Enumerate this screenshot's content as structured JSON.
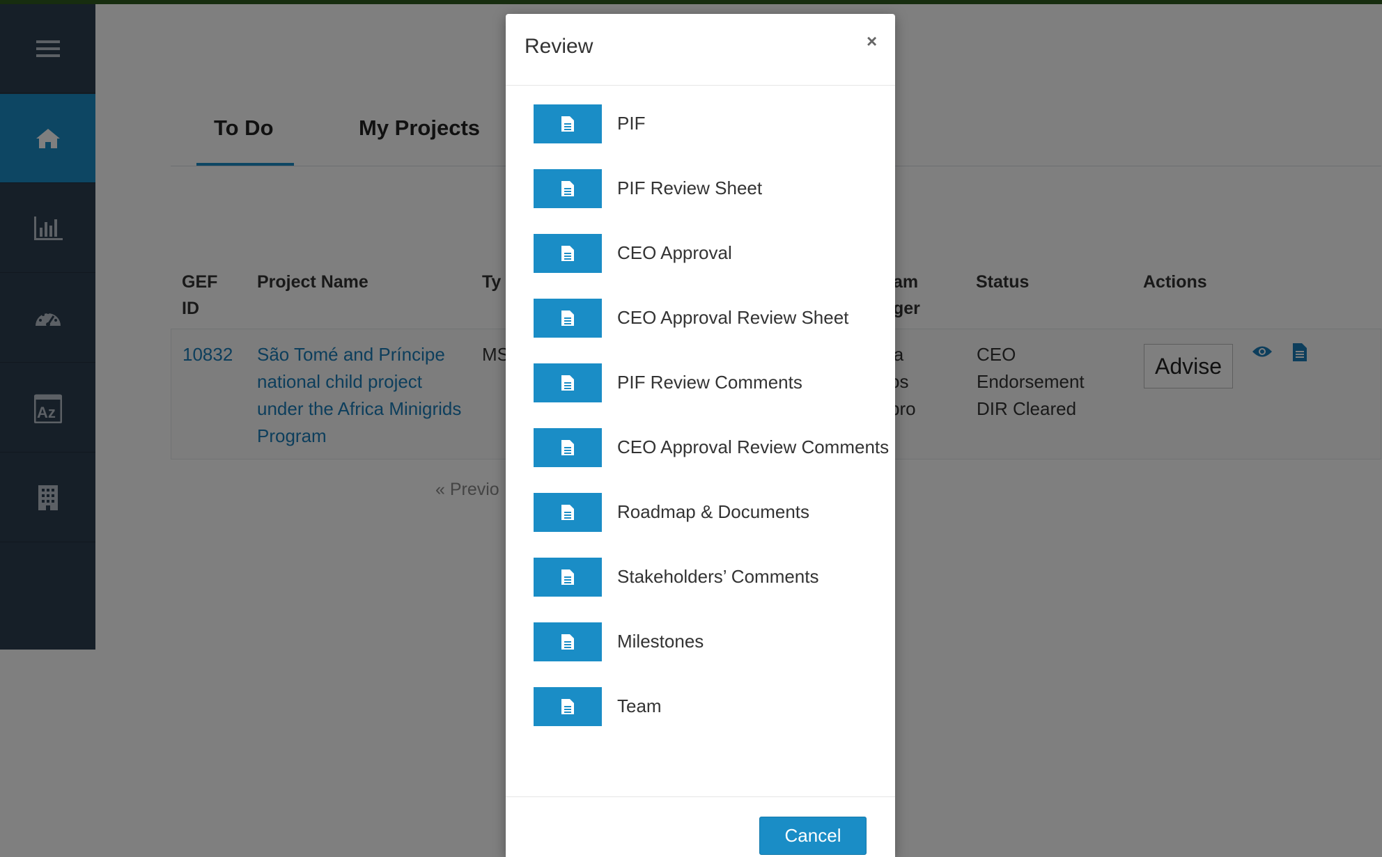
{
  "sidebar": {
    "items": [
      {
        "icon": "menu-icon"
      },
      {
        "icon": "home-icon"
      },
      {
        "icon": "bar-chart-icon"
      },
      {
        "icon": "dashboard-icon"
      },
      {
        "icon": "sort-az-icon"
      },
      {
        "icon": "building-icon"
      }
    ]
  },
  "main": {
    "tabs": [
      {
        "label": "To Do",
        "active": true
      },
      {
        "label": "My Projects",
        "active": false
      }
    ],
    "table": {
      "headers": {
        "gef_id": "GEF ID",
        "project_name": "Project Name",
        "type": "Ty",
        "program_manager": "am ger",
        "status": "Status",
        "actions": "Actions"
      },
      "row": {
        "gef_id": "10832",
        "project_name": "São Tomé and Príncipe national child project under the Africa Minigrids Program",
        "type": "MS",
        "program_manager": "ia os bro",
        "status": "CEO Endorsement DIR Cleared",
        "advise_label": "Advise"
      }
    },
    "pager": {
      "previous": "« Previo"
    }
  },
  "modal": {
    "title": "Review",
    "close": "×",
    "items": [
      "PIF",
      "PIF Review Sheet",
      "CEO Approval",
      "CEO Approval Review Sheet",
      "PIF Review Comments",
      "CEO Approval Review Comments",
      "Roadmap & Documents",
      "Stakeholders’ Comments",
      "Milestones",
      "Team"
    ],
    "cancel_label": "Cancel"
  },
  "colors": {
    "accent": "#1a8dc6",
    "sidebar": "#2c3e50",
    "link": "#1a7db8",
    "top_strip": "#2e5a1f"
  }
}
